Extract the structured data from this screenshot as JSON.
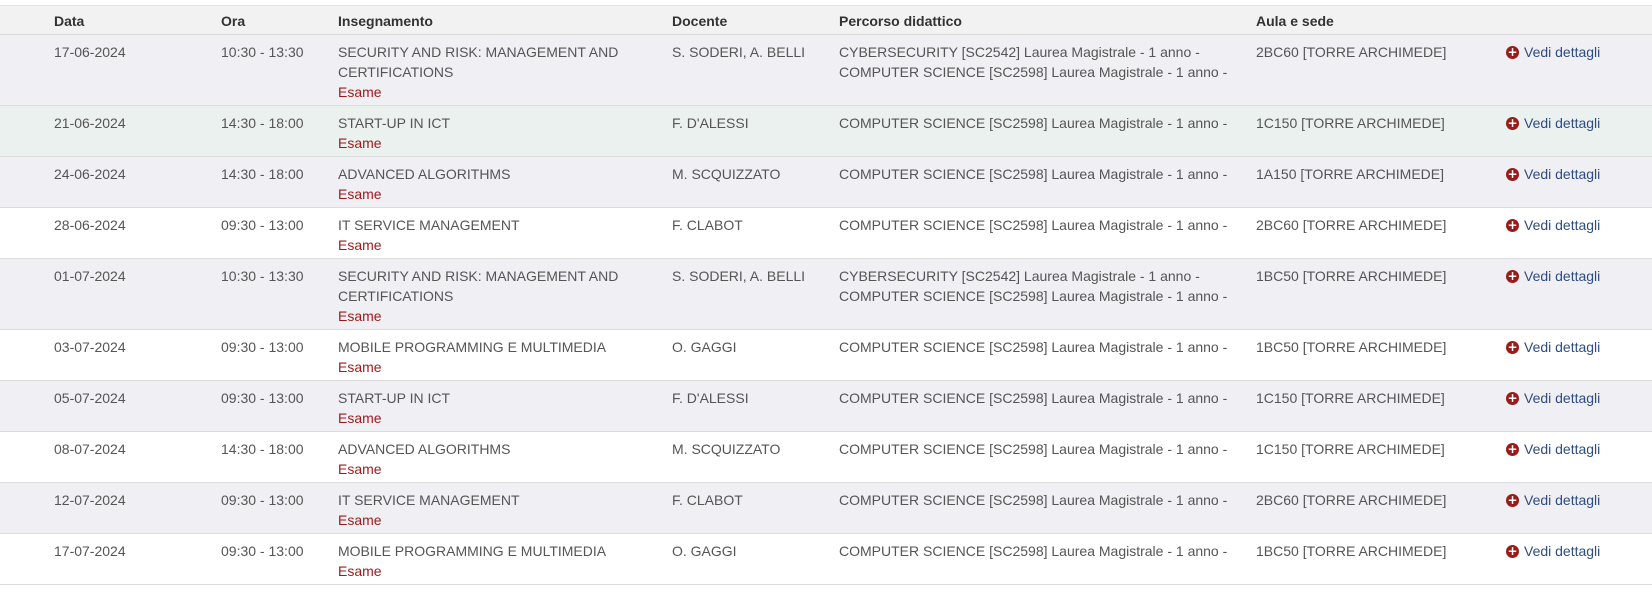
{
  "headers": {
    "date": "Data",
    "time": "Ora",
    "course": "Insegnamento",
    "teacher": "Docente",
    "path": "Percorso didattico",
    "room": "Aula e sede"
  },
  "detail_label": "Vedi dettagli",
  "rows": [
    {
      "date": "17-06-2024",
      "time": "10:30 - 13:30",
      "course_lines": [
        "SECURITY AND RISK: MANAGEMENT AND",
        "CERTIFICATIONS"
      ],
      "type": "Esame",
      "teacher": "S. SODERI, A. BELLI",
      "path_lines": [
        "CYBERSECURITY [SC2542] Laurea Magistrale - 1 anno -",
        "COMPUTER SCIENCE [SC2598] Laurea Magistrale - 1 anno -"
      ],
      "room": "2BC60 [TORRE ARCHIMEDE]"
    },
    {
      "date": "21-06-2024",
      "time": "14:30 - 18:00",
      "course_lines": [
        "START-UP IN ICT"
      ],
      "type": "Esame",
      "teacher": "F. D'ALESSI",
      "path_lines": [
        "COMPUTER SCIENCE [SC2598] Laurea Magistrale - 1 anno -"
      ],
      "room": "1C150 [TORRE ARCHIMEDE]"
    },
    {
      "date": "24-06-2024",
      "time": "14:30 - 18:00",
      "course_lines": [
        "ADVANCED ALGORITHMS"
      ],
      "type": "Esame",
      "teacher": "M. SCQUIZZATO",
      "path_lines": [
        "COMPUTER SCIENCE [SC2598] Laurea Magistrale - 1 anno -"
      ],
      "room": "1A150 [TORRE ARCHIMEDE]"
    },
    {
      "date": "28-06-2024",
      "time": "09:30 - 13:00",
      "course_lines": [
        "IT SERVICE MANAGEMENT"
      ],
      "type": "Esame",
      "teacher": "F. CLABOT",
      "path_lines": [
        "COMPUTER SCIENCE [SC2598] Laurea Magistrale - 1 anno -"
      ],
      "room": "2BC60 [TORRE ARCHIMEDE]"
    },
    {
      "date": "01-07-2024",
      "time": "10:30 - 13:30",
      "course_lines": [
        "SECURITY AND RISK: MANAGEMENT AND",
        "CERTIFICATIONS"
      ],
      "type": "Esame",
      "teacher": "S. SODERI, A. BELLI",
      "path_lines": [
        "CYBERSECURITY [SC2542] Laurea Magistrale - 1 anno -",
        "COMPUTER SCIENCE [SC2598] Laurea Magistrale - 1 anno -"
      ],
      "room": "1BC50 [TORRE ARCHIMEDE]"
    },
    {
      "date": "03-07-2024",
      "time": "09:30 - 13:00",
      "course_lines": [
        "MOBILE PROGRAMMING E MULTIMEDIA"
      ],
      "type": "Esame",
      "teacher": "O. GAGGI",
      "path_lines": [
        "COMPUTER SCIENCE [SC2598] Laurea Magistrale - 1 anno -"
      ],
      "room": "1BC50 [TORRE ARCHIMEDE]"
    },
    {
      "date": "05-07-2024",
      "time": "09:30 - 13:00",
      "course_lines": [
        "START-UP IN ICT"
      ],
      "type": "Esame",
      "teacher": "F. D'ALESSI",
      "path_lines": [
        "COMPUTER SCIENCE [SC2598] Laurea Magistrale - 1 anno -"
      ],
      "room": "1C150 [TORRE ARCHIMEDE]"
    },
    {
      "date": "08-07-2024",
      "time": "14:30 - 18:00",
      "course_lines": [
        "ADVANCED ALGORITHMS"
      ],
      "type": "Esame",
      "teacher": "M. SCQUIZZATO",
      "path_lines": [
        "COMPUTER SCIENCE [SC2598] Laurea Magistrale - 1 anno -"
      ],
      "room": "1C150 [TORRE ARCHIMEDE]"
    },
    {
      "date": "12-07-2024",
      "time": "09:30 - 13:00",
      "course_lines": [
        "IT SERVICE MANAGEMENT"
      ],
      "type": "Esame",
      "teacher": "F. CLABOT",
      "path_lines": [
        "COMPUTER SCIENCE [SC2598] Laurea Magistrale - 1 anno -"
      ],
      "room": "2BC60 [TORRE ARCHIMEDE]"
    },
    {
      "date": "17-07-2024",
      "time": "09:30 - 13:00",
      "course_lines": [
        "MOBILE PROGRAMMING E MULTIMEDIA"
      ],
      "type": "Esame",
      "teacher": "O. GAGGI",
      "path_lines": [
        "COMPUTER SCIENCE [SC2598] Laurea Magistrale - 1 anno -"
      ],
      "room": "1BC50 [TORRE ARCHIMEDE]"
    }
  ]
}
